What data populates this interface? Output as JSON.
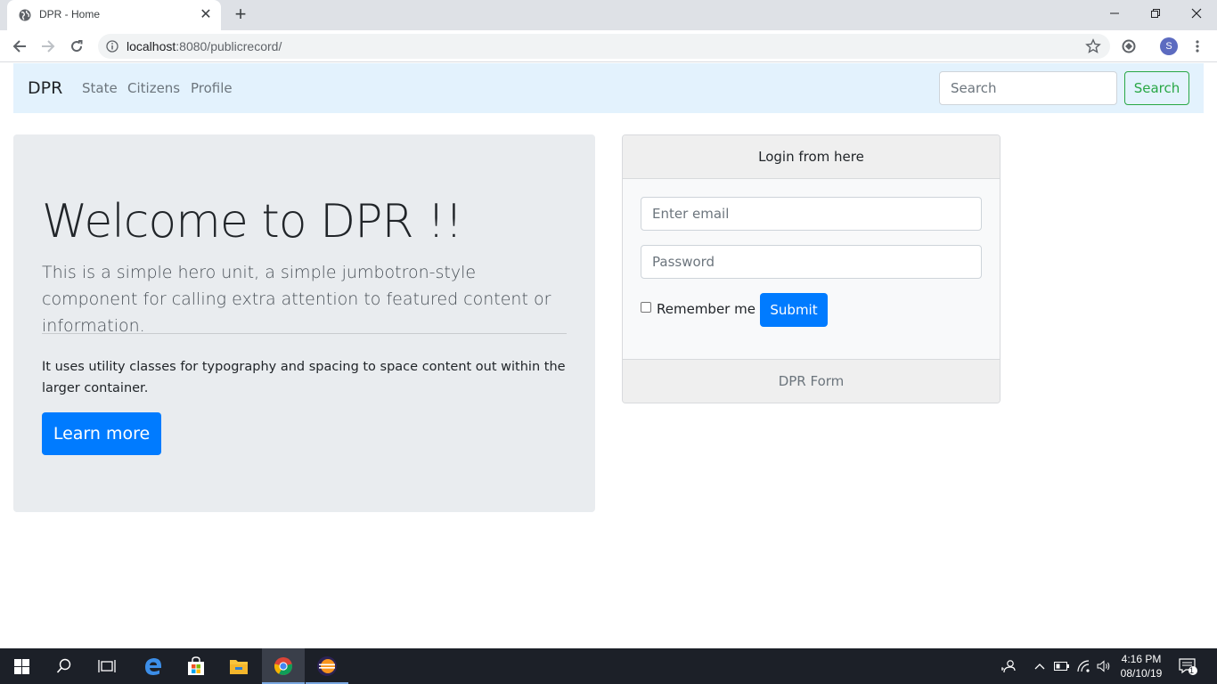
{
  "browser": {
    "tab_title": "DPR - Home",
    "url_host": "localhost",
    "url_rest": ":8080/publicrecord/",
    "profile_initial": "S"
  },
  "navbar": {
    "brand": "DPR",
    "links": [
      "State",
      "Citizens",
      "Profile"
    ],
    "search_placeholder": "Search",
    "search_button": "Search"
  },
  "jumbotron": {
    "title": "Welcome to DPR !!",
    "lead": "This is a simple hero unit, a simple jumbotron-style component for calling extra attention to featured content or information.",
    "text": "It uses utility classes for typography and spacing to space content out within the larger container.",
    "button": "Learn more"
  },
  "login_card": {
    "header": "Login from here",
    "email_placeholder": "Enter email",
    "password_placeholder": "Password",
    "remember_label": "Remember me",
    "submit_label": "Submit",
    "footer": "DPR Form"
  },
  "taskbar": {
    "time": "4:16 PM",
    "date": "08/10/19",
    "notification_count": "1"
  },
  "colors": {
    "primary": "#007bff",
    "success": "#28a745",
    "navbar_bg": "#e3f2fd",
    "jumbotron_bg": "#e9ecef"
  }
}
